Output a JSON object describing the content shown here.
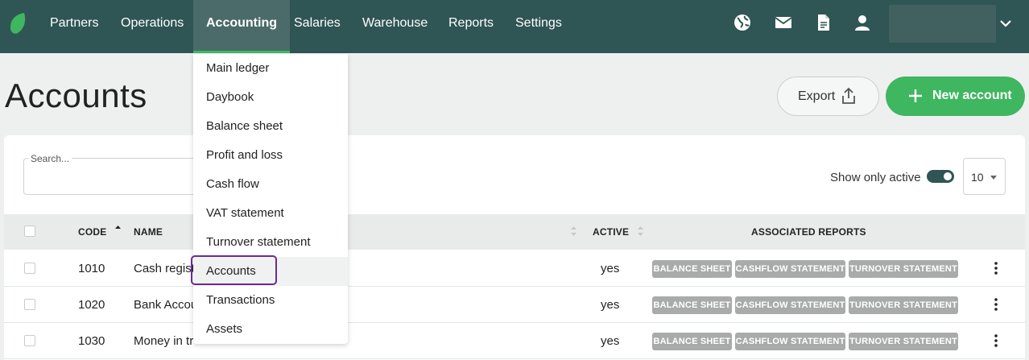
{
  "nav": {
    "items": [
      "Partners",
      "Operations",
      "Accounting",
      "Salaries",
      "Warehouse",
      "Reports",
      "Settings"
    ],
    "active": "Accounting"
  },
  "icons": [
    "globe-icon",
    "mail-icon",
    "document-icon",
    "user-icon",
    "chevron-down-icon"
  ],
  "colors": {
    "header": "#2f5554",
    "accent_green": "#3fb660",
    "focus_purple": "#6b2d8c",
    "badge_gray": "#a9abaa"
  },
  "page": {
    "title": "Accounts",
    "export_label": "Export",
    "new_label": "New account"
  },
  "filters": {
    "search_placeholder": "Search...",
    "show_only_active_label": "Show only active",
    "per_page": "10"
  },
  "table": {
    "headers": {
      "code": "CODE",
      "name": "NAME",
      "active": "ACTIVE",
      "reports": "ASSOCIATED REPORTS"
    },
    "rows": [
      {
        "code": "1010",
        "name": "Cash regist",
        "active": "yes"
      },
      {
        "code": "1020",
        "name": "Bank Accou",
        "active": "yes"
      },
      {
        "code": "1030",
        "name": "Money in tr",
        "active": "yes"
      }
    ],
    "badges": [
      "BALANCE SHEET",
      "CASHFLOW STATEMENT",
      "TURNOVER STATEMENT"
    ]
  },
  "menu": {
    "items": [
      "Main ledger",
      "Daybook",
      "Balance sheet",
      "Profit and loss",
      "Cash flow",
      "VAT statement",
      "Turnover statement",
      "Accounts",
      "Transactions",
      "Assets"
    ],
    "highlighted": "Accounts"
  }
}
